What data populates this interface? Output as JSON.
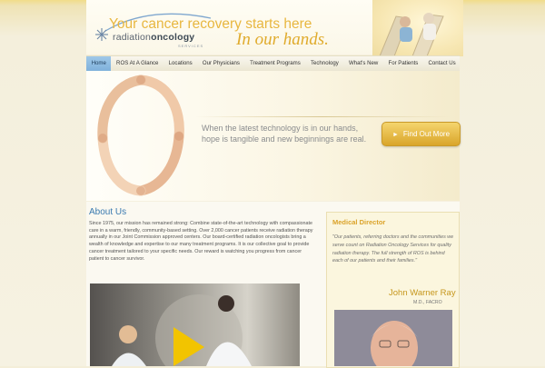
{
  "brand": {
    "name_light": "radiation",
    "name_bold": "oncology",
    "tagline": "SERVICES"
  },
  "nav": {
    "items": [
      {
        "label": "Home",
        "active": true
      },
      {
        "label": "ROS At A Glance",
        "active": false
      },
      {
        "label": "Locations",
        "active": false
      },
      {
        "label": "Our Physicians",
        "active": false
      },
      {
        "label": "Treatment Programs",
        "active": false
      },
      {
        "label": "Technology",
        "active": false
      },
      {
        "label": "What's New",
        "active": false
      },
      {
        "label": "For Patients",
        "active": false
      },
      {
        "label": "Contact Us",
        "active": false
      }
    ]
  },
  "hero": {
    "title": "Your cancer recovery starts here",
    "subtitle": "In our hands.",
    "body_line1": "When the latest technology is in our hands,",
    "body_line2": "hope is tangible and new beginnings are real.",
    "cta_label": "Find Out More"
  },
  "about": {
    "title": "About Us",
    "text": "Since 1975, our mission has remained strong: Combine state-of-the-art technology with compassionate care in a warm, friendly, community-based setting. Over 2,000 cancer patients receive radiation therapy annually in our Joint Commission approved centers. Our board-certified radiation oncologists bring a wealth of knowledge and expertise to our many treatment programs. It is our collective goal to provide cancer treatment tailored to your specific needs. Our reward is watching you progress from cancer patient to cancer survivor."
  },
  "director": {
    "section_title": "Medical Director",
    "quote": "\"Our patients, referring doctors and the communities we serve count on Radiation Oncology Services for quality radiation therapy. The full strength of ROS is behind each of our patients and their families.\"",
    "name": "John Warner Ray",
    "credentials": "M.D., FACRO"
  },
  "colors": {
    "accent_gold": "#e0ab2c",
    "link_blue": "#3a7ab0",
    "nav_active": "#8fbde2"
  }
}
